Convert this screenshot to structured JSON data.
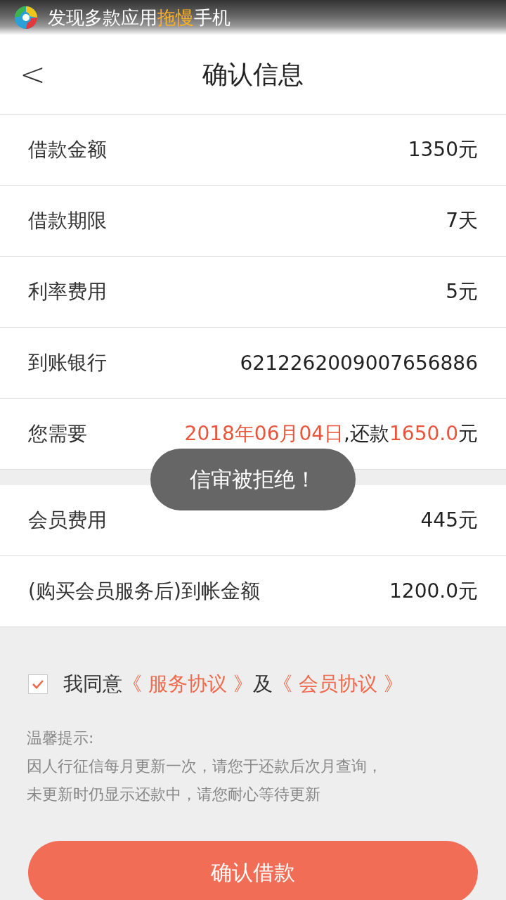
{
  "notification": {
    "segments": [
      {
        "text": "发现多款应用",
        "kind": "plain"
      },
      {
        "text": "拖慢",
        "kind": "accent"
      },
      {
        "text": "手机",
        "kind": "plain"
      }
    ]
  },
  "header": {
    "back": "<",
    "title": "确认信息"
  },
  "groups": [
    {
      "rows": [
        {
          "label": "借款金额",
          "value": [
            {
              "text": "1350元",
              "kind": "plain"
            }
          ]
        },
        {
          "label": "借款期限",
          "value": [
            {
              "text": "7天",
              "kind": "plain"
            }
          ]
        },
        {
          "label": "利率费用",
          "value": [
            {
              "text": "5元",
              "kind": "plain"
            }
          ]
        },
        {
          "label": "到账银行",
          "value": [
            {
              "text": "6212262009007656886",
              "kind": "plain"
            }
          ]
        },
        {
          "label": "您需要",
          "value": [
            {
              "text": "2018年06月04日",
              "kind": "accent"
            },
            {
              "text": ",还款",
              "kind": "plain"
            },
            {
              "text": "1650.0",
              "kind": "accent"
            },
            {
              "text": "元",
              "kind": "plain"
            }
          ]
        }
      ]
    },
    {
      "rows": [
        {
          "label": "会员费用",
          "value": [
            {
              "text": "445元",
              "kind": "plain"
            }
          ]
        },
        {
          "label": "(购买会员服务后)到帐金额",
          "value": [
            {
              "text": "1200.0元",
              "kind": "plain"
            }
          ]
        }
      ]
    }
  ],
  "agreement": {
    "checked": true,
    "parts": [
      {
        "text": "我同意",
        "kind": "plain"
      },
      {
        "text": "《 服务协议 》",
        "kind": "link"
      },
      {
        "text": "及",
        "kind": "plain"
      },
      {
        "text": "《 会员协议 》",
        "kind": "link"
      }
    ]
  },
  "tips": [
    "温馨提示:",
    "因人行征信每月更新一次，请您于还款后次月查询，",
    "未更新时仍显示还款中，请您耐心等待更新"
  ],
  "confirm_button": "确认借款",
  "toast": "信审被拒绝！"
}
